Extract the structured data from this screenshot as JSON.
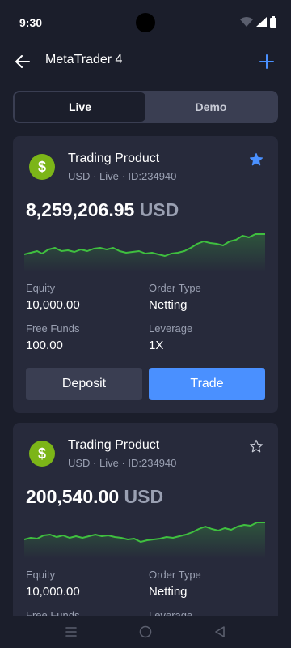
{
  "status_bar": {
    "time": "9:30"
  },
  "header": {
    "title": "MetaTrader 4"
  },
  "tabs": [
    {
      "label": "Live",
      "active": true
    },
    {
      "label": "Demo",
      "active": false
    }
  ],
  "accounts": [
    {
      "icon": "dollar-icon",
      "icon_symbol": "$",
      "name": "Trading Product",
      "meta": "USD · Live · ID:234940",
      "favorite": true,
      "balance": "8,259,206.95",
      "currency": "USD",
      "equity_label": "Equity",
      "equity_value": "10,000.00",
      "order_type_label": "Order Type",
      "order_type_value": "Netting",
      "free_funds_label": "Free Funds",
      "free_funds_value": "100.00",
      "leverage_label": "Leverage",
      "leverage_value": "1X",
      "deposit_label": "Deposit",
      "trade_label": "Trade"
    },
    {
      "icon": "dollar-icon",
      "icon_symbol": "$",
      "name": "Trading Product",
      "meta": "USD · Live · ID:234940",
      "favorite": false,
      "balance": "200,540.00",
      "currency": "USD",
      "equity_label": "Equity",
      "equity_value": "10,000.00",
      "order_type_label": "Order Type",
      "order_type_value": "Netting",
      "free_funds_label": "Free Funds",
      "leverage_label": "Leverage"
    }
  ],
  "colors": {
    "background": "#1b1e2b",
    "card": "#272a3b",
    "accent": "#4a90ff",
    "positive": "#3fbf3f",
    "product_icon": "#7cb518",
    "muted_text": "#9aa0b2"
  },
  "icons": {
    "back": "arrow-left-icon",
    "add": "plus-icon",
    "star_filled": "star-filled-icon",
    "star_outline": "star-outline-icon",
    "nav_menu": "menu-icon",
    "nav_home": "circle-home-icon",
    "nav_back": "triangle-back-icon"
  }
}
